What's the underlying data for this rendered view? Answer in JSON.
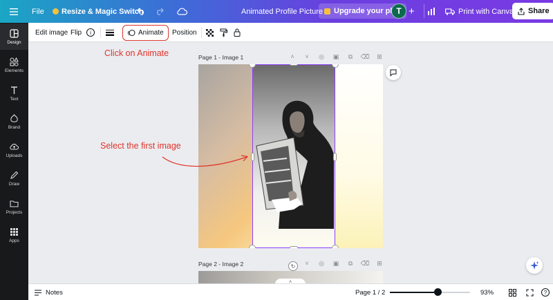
{
  "topbar": {
    "menu_icon": "hamburger-icon",
    "file_label": "File",
    "resize_label": "Resize & Magic Switch",
    "doc_title": "Animated Profile Picture",
    "upgrade_label": "Upgrade your plan",
    "avatar_letter": "T",
    "print_label": "Print with Canva",
    "share_label": "Share"
  },
  "sidebar": {
    "items": [
      {
        "label": "Design",
        "icon": "layout-icon"
      },
      {
        "label": "Elements",
        "icon": "shapes-icon"
      },
      {
        "label": "Text",
        "icon": "text-icon"
      },
      {
        "label": "Brand",
        "icon": "brand-icon"
      },
      {
        "label": "Uploads",
        "icon": "upload-cloud-icon"
      },
      {
        "label": "Draw",
        "icon": "pen-icon"
      },
      {
        "label": "Projects",
        "icon": "folder-icon"
      },
      {
        "label": "Apps",
        "icon": "grid-icon"
      }
    ]
  },
  "toolbar": {
    "edit_image": "Edit image",
    "flip": "Flip",
    "animate": "Animate",
    "position": "Position"
  },
  "annotations": {
    "animate_hint": "Click on Animate",
    "select_hint": "Select the first image"
  },
  "pages": {
    "page1_label": "Page 1 - Image 1",
    "page2_label": "Page 2 - Image 2"
  },
  "bottombar": {
    "notes_label": "Notes",
    "page_indicator": "Page 1 / 2",
    "zoom": "93%",
    "zoom_fraction": 0.6
  },
  "colors": {
    "accent": "#7a3ae3",
    "annotation": "#e0342b",
    "selection": "#8b3dff"
  }
}
